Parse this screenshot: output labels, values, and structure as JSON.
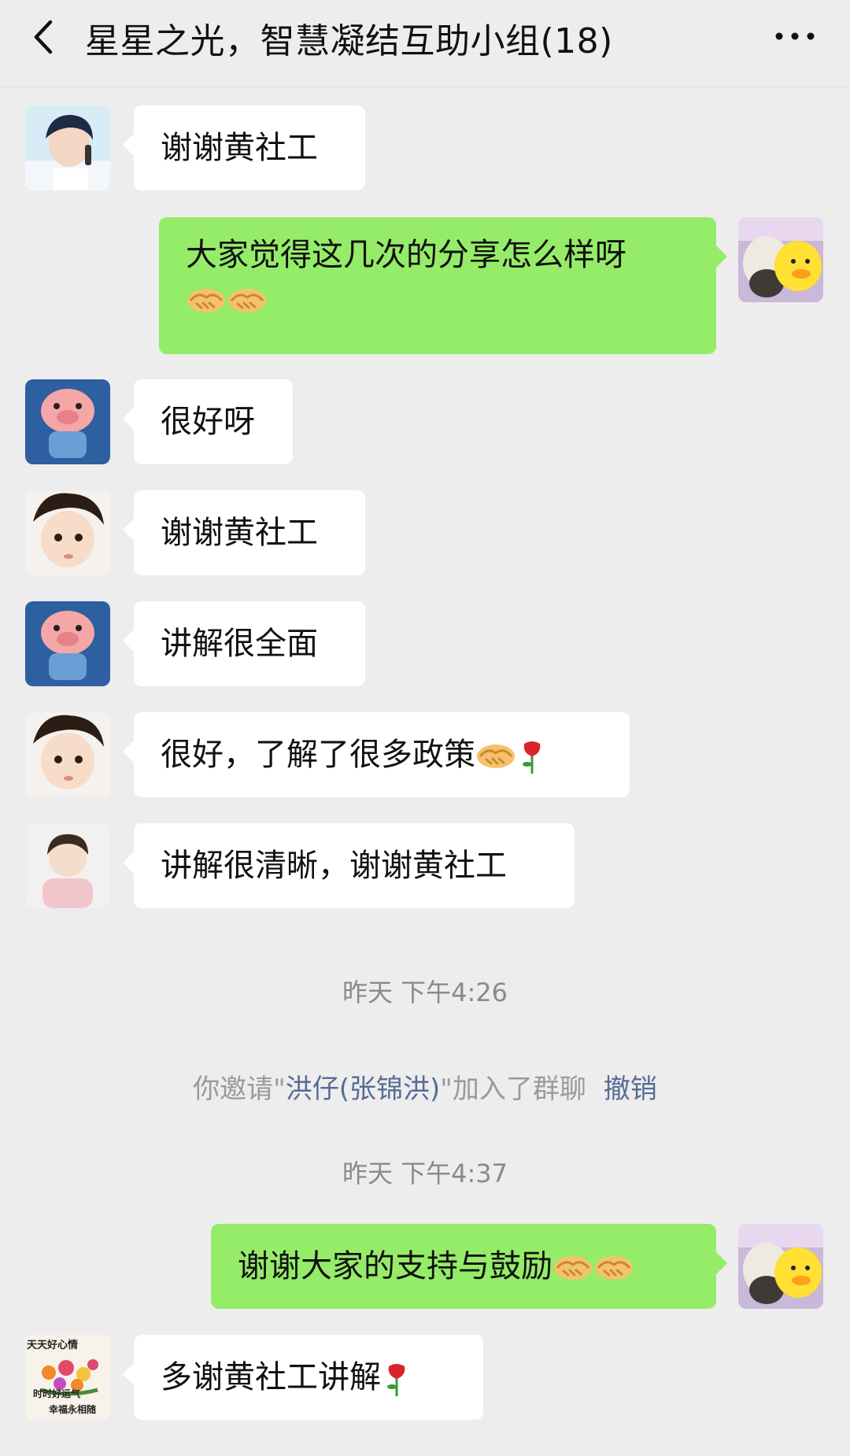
{
  "header": {
    "title": "星星之光，智慧凝结互助小组(18)",
    "back_icon": "chevron-left-icon",
    "more_icon": "more-dots-icon"
  },
  "messages": [
    {
      "side": "in",
      "text": "谢谢黄社工",
      "emojis": []
    },
    {
      "side": "out",
      "text": "大家觉得这几次的分享怎么样呀",
      "emojis": [
        "handshake",
        "handshake"
      ]
    },
    {
      "side": "in",
      "text": "很好呀",
      "emojis": []
    },
    {
      "side": "in",
      "text": "谢谢黄社工",
      "emojis": []
    },
    {
      "side": "in",
      "text": "讲解很全面",
      "emojis": []
    },
    {
      "side": "in",
      "text": "很好，了解了很多政策",
      "emojis": [
        "handshake",
        "rose"
      ]
    },
    {
      "side": "in",
      "text": "讲解很清晰，谢谢黄社工",
      "emojis": []
    },
    {
      "side": "out",
      "text": "谢谢大家的支持与鼓励",
      "emojis": [
        "handshake",
        "handshake"
      ]
    },
    {
      "side": "in",
      "text": "多谢黄社工讲解",
      "emojis": [
        "rose"
      ]
    }
  ],
  "timestamps": [
    "昨天 下午4:26",
    "昨天 下午4:37"
  ],
  "system_message": {
    "prefix": "你邀请\"",
    "name": "洪仔(张锦洪)",
    "suffix": "\"加入了群聊",
    "action": "撤销"
  },
  "last_avatar_text": [
    "天天好心情",
    "时时好运气",
    "幸福永相随"
  ],
  "colors": {
    "background": "#ededed",
    "outgoing_bubble": "#95ec69",
    "incoming_bubble": "#ffffff",
    "link": "#576b95"
  }
}
